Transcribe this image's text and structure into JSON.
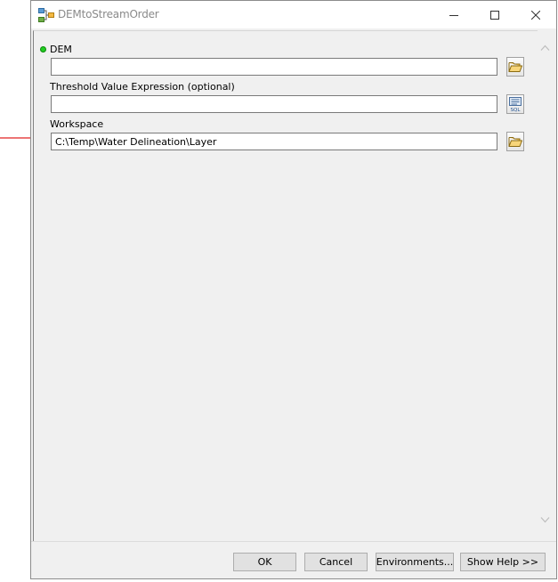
{
  "window": {
    "title": "DEMtoStreamOrder"
  },
  "params": {
    "dem": {
      "label": "DEM",
      "value": "",
      "required": true
    },
    "threshold": {
      "label": "Threshold Value Expression (optional)",
      "value": ""
    },
    "workspace": {
      "label": "Workspace",
      "value": "C:\\Temp\\Water Delineation\\Layer"
    }
  },
  "buttons": {
    "ok": "OK",
    "cancel": "Cancel",
    "environments": "Environments...",
    "show_help": "Show Help >>"
  },
  "colors": {
    "annotation_arrow": "#e02020",
    "required_dot": "#22cc22",
    "title_text": "#8a8a8a"
  },
  "icons": {
    "app": "model-tool-icon",
    "browse": "folder-open-icon",
    "sql": "sql-icon"
  }
}
